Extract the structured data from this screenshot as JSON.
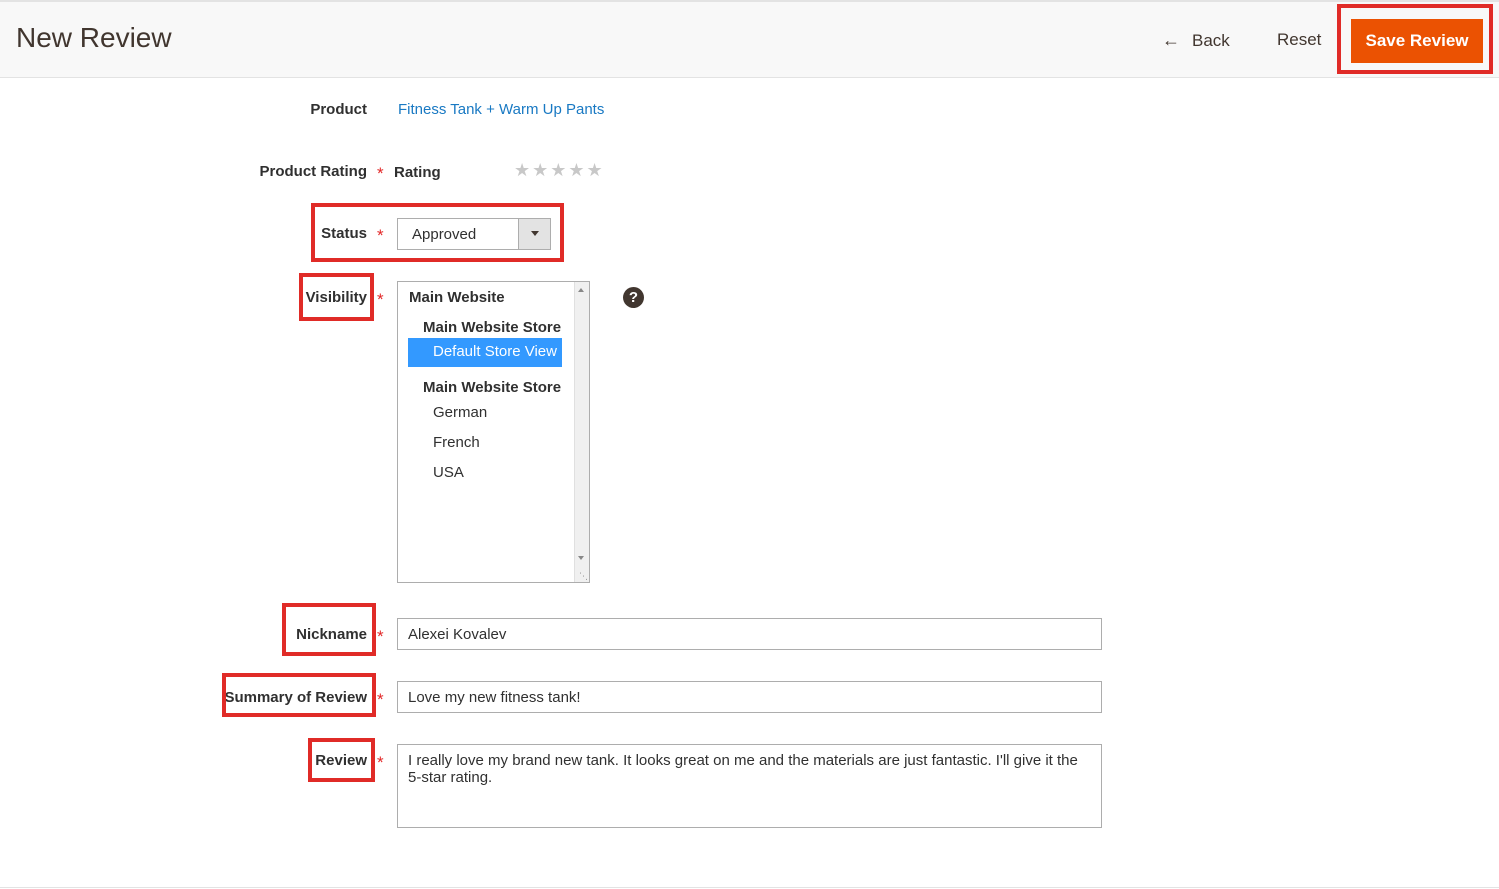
{
  "header": {
    "title": "New Review",
    "back_label": "Back",
    "reset_label": "Reset",
    "save_label": "Save Review"
  },
  "form": {
    "product": {
      "label": "Product",
      "value": "Fitness Tank + Warm Up Pants"
    },
    "product_rating": {
      "label": "Product Rating",
      "rating_label": "Rating",
      "stars": "★★★★★",
      "rating_value": 0,
      "rating_max": 5
    },
    "status": {
      "label": "Status",
      "value": "Approved"
    },
    "visibility": {
      "label": "Visibility",
      "help": "?",
      "items": [
        {
          "text": "Main Website",
          "type": "website"
        },
        {
          "text": "Main Website Store",
          "type": "store"
        },
        {
          "text": "Default Store View",
          "type": "view",
          "selected": true
        },
        {
          "text": "Main Website Store",
          "type": "store"
        },
        {
          "text": "German",
          "type": "view"
        },
        {
          "text": "French",
          "type": "view"
        },
        {
          "text": "USA",
          "type": "view"
        }
      ]
    },
    "nickname": {
      "label": "Nickname",
      "value": "Alexei Kovalev"
    },
    "summary": {
      "label": "Summary of Review",
      "value": "Love my new fitness tank!"
    },
    "review": {
      "label": "Review",
      "value": "I really love my brand new tank. It looks great on me and the materials are just fantastic. I'll give it the 5-star rating."
    },
    "required_mark": "*"
  },
  "colors": {
    "accent": "#eb5202",
    "link": "#1979c3",
    "required": "#e22626",
    "highlight_box": "#e02b27",
    "selection": "#3399ff"
  }
}
